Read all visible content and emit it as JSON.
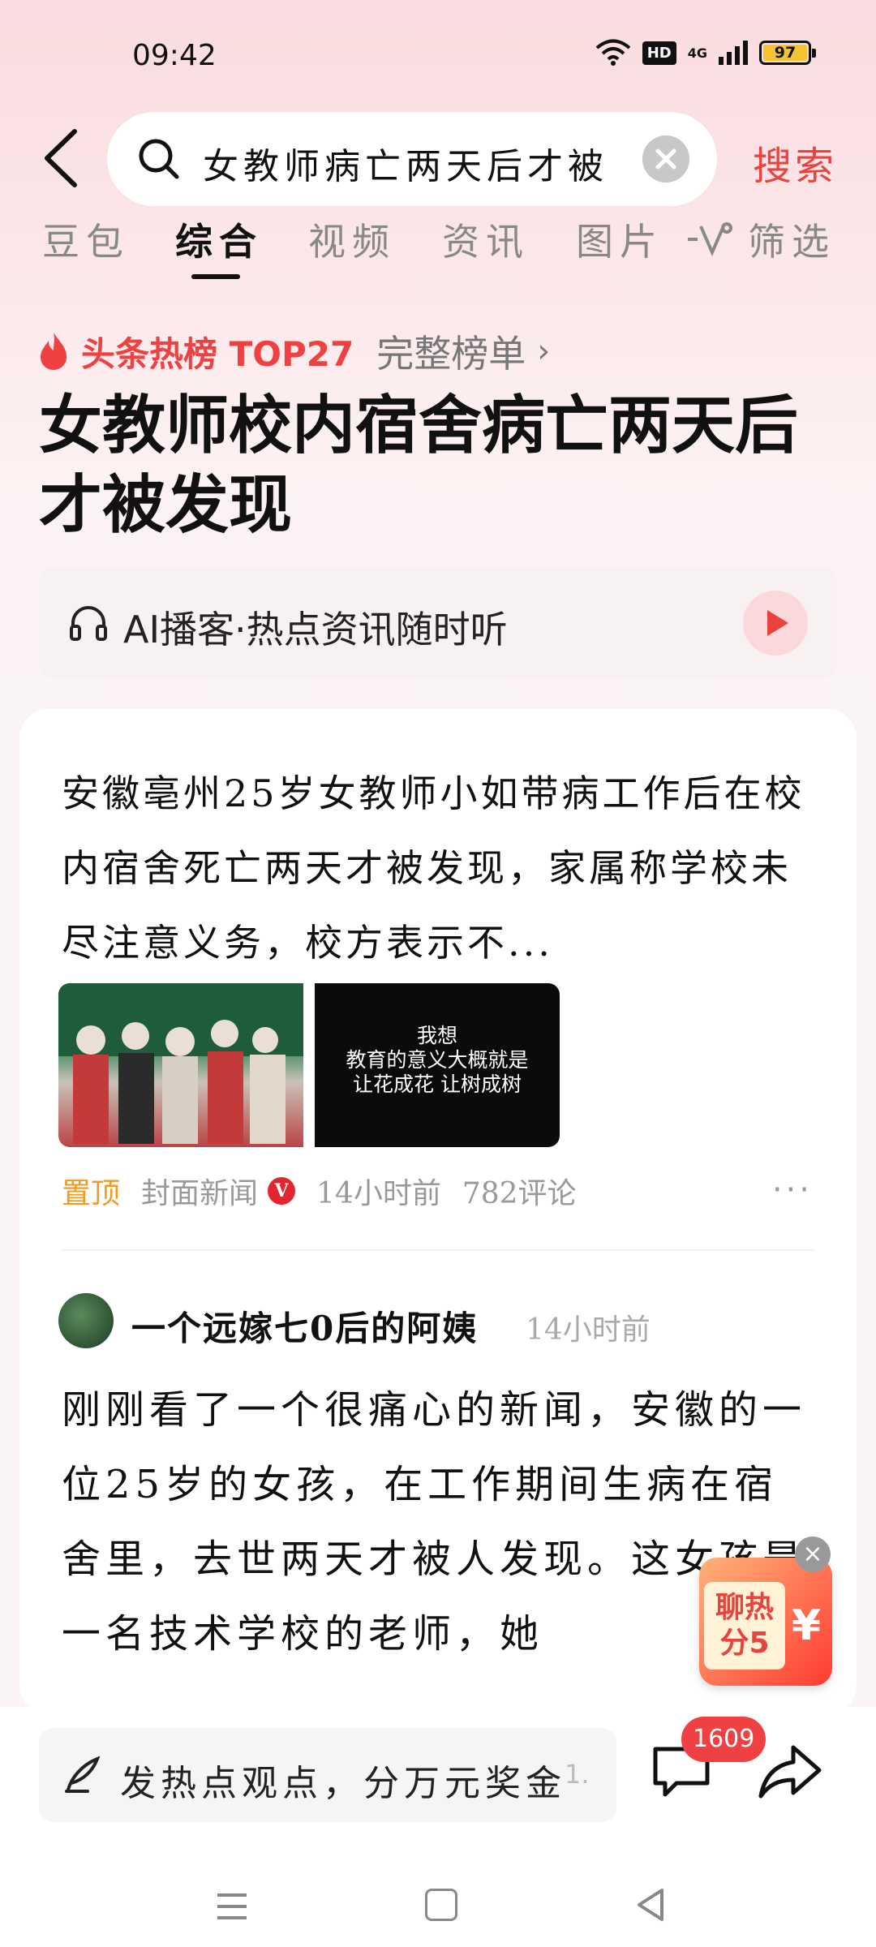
{
  "status": {
    "time": "09:42",
    "hd": "HD",
    "signal": "4G",
    "battery": "97"
  },
  "search": {
    "query": "女教师病亡两天后才被",
    "button": "搜索"
  },
  "tabs": [
    {
      "label": "豆包"
    },
    {
      "label": "综合"
    },
    {
      "label": "视频"
    },
    {
      "label": "资讯"
    },
    {
      "label": "图片"
    }
  ],
  "filter_label": "筛选",
  "hotlist": {
    "title": "头条热榜 TOP27",
    "link": "完整榜单"
  },
  "headline": "女教师校内宿舍病亡两天后才被发现",
  "podcast": {
    "label": "AI播客·热点资讯随时听"
  },
  "article": {
    "summary": "安徽亳州25岁女教师小如带病工作后在校内宿舍死亡两天才被发现，家属称学校未尽注意义务，校方表示不...",
    "thumb_caption": "我想\n教育的意义大概就是\n让花成花 让树成树",
    "pinned": "置顶",
    "source": "封面新闻",
    "verified": "V",
    "time": "14小时前",
    "comments": "782评论",
    "more": "···"
  },
  "post": {
    "author": "一个远嫁七0后的阿姨",
    "time": "14小时前",
    "text": "刚刚看了一个很痛心的新闻，安徽的一位25岁的女孩，在工作期间生病在宿舍里，去世两天才被人发现。这女孩是一名技术学校的老师，她"
  },
  "redpacket": {
    "line1": "聊热",
    "line2": "分5",
    "yen": "¥"
  },
  "bottom": {
    "input_placeholder": "发热点观点，分万元奖金",
    "input_extra": "1.",
    "comment_count": "1609"
  },
  "colors": {
    "accent": "#f04142",
    "search_button": "#e8433c",
    "pinned": "#f19a1f"
  }
}
